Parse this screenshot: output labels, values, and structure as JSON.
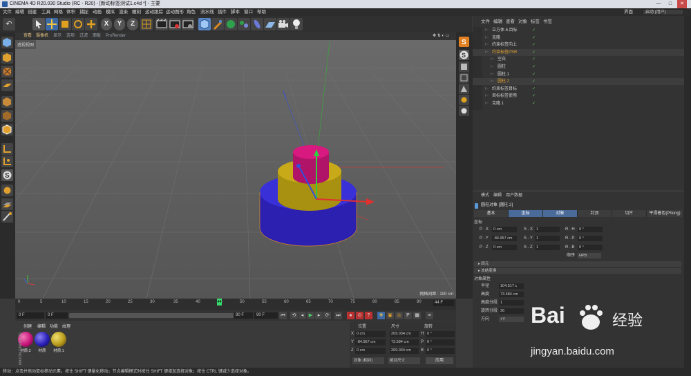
{
  "window": {
    "title": "CINEMA 4D R20.030 Studio (RC - R20) - [新动标签测试1.c4d *] - 主要",
    "min_label": "—",
    "max_label": "□",
    "close_label": "✕"
  },
  "menubar": {
    "items": [
      "文件",
      "编辑",
      "创建",
      "工具",
      "网格",
      "体积",
      "捕捉",
      "动画",
      "模拟",
      "渲染",
      "雕刻",
      "运动跟踪",
      "运动图形",
      "角色",
      "流水线",
      "插件",
      "脚本",
      "窗口",
      "帮助"
    ],
    "layout_label": "界面",
    "layout_value": "启动 (用户)"
  },
  "viewport": {
    "menu": [
      "查看",
      "摄像机",
      "显示",
      "选项",
      "过滤",
      "面板",
      "ProRender"
    ],
    "title": "透视视图",
    "grid_info": "网格间距 : 100 cm"
  },
  "timeline": {
    "ticks": [
      "0",
      "5",
      "10",
      "15",
      "20",
      "25",
      "30",
      "35",
      "40",
      "45",
      "50",
      "55",
      "60",
      "65",
      "70",
      "75",
      "80",
      "85",
      "90"
    ],
    "current_frame": "44",
    "end_label": "44 F"
  },
  "transport": {
    "start": "0 F",
    "cur": "0 F",
    "end": "90 F",
    "end2": "90 F"
  },
  "materials": {
    "tabs": [
      "创建",
      "编辑",
      "功能",
      "纹理"
    ],
    "items": [
      {
        "label": "材质.2",
        "color": "#c8157a"
      },
      {
        "label": "材质",
        "color": "#2a1fb8"
      },
      {
        "label": "材质.1",
        "color": "#b89a1a"
      }
    ]
  },
  "coords": {
    "headers": [
      "位置",
      "尺寸",
      "旋转"
    ],
    "rows": [
      {
        "axis": "X",
        "pos": "0 cm",
        "size": "209.034 cm",
        "rot_label": "H",
        "rot": "0 °"
      },
      {
        "axis": "Y",
        "pos": "-84.957 cm",
        "size": "73.584 cm",
        "rot_label": "P",
        "rot": "0 °"
      },
      {
        "axis": "Z",
        "pos": "0 cm",
        "size": "209.034 cm",
        "rot_label": "B",
        "rot": "0 °"
      }
    ],
    "mode_left": "对象 (相对)",
    "mode_right": "绝对尺寸",
    "apply": "应用"
  },
  "objects": {
    "tabs": [
      "文件",
      "编辑",
      "查看",
      "对象",
      "标签",
      "书签"
    ],
    "rows": [
      {
        "name": "立方体.6.目标",
        "indent": 0,
        "color": "#cfcfcf"
      },
      {
        "name": "克隆",
        "indent": 0,
        "color": "#cfcfcf"
      },
      {
        "name": "约束标签向上",
        "indent": 0,
        "color": "#cfcfcf"
      },
      {
        "name": "约束标签PSR",
        "indent": 0,
        "color": "#e0a030"
      },
      {
        "name": "空白",
        "indent": 1,
        "color": "#cfcfcf"
      },
      {
        "name": "圆柱",
        "indent": 1,
        "color": "#cfcfcf"
      },
      {
        "name": "圆柱.1",
        "indent": 1,
        "color": "#cfcfcf"
      },
      {
        "name": "圆柱.2",
        "indent": 1,
        "color": "#e0a030"
      },
      {
        "name": "约束标签目标",
        "indent": 0,
        "color": "#cfcfcf"
      },
      {
        "name": "目标标签使用",
        "indent": 0,
        "color": "#cfcfcf"
      },
      {
        "name": "克隆.1",
        "indent": 0,
        "color": "#cfcfcf"
      }
    ]
  },
  "attributes": {
    "tabs": [
      "模式",
      "编辑",
      "用户数据"
    ],
    "object_title": "圆柱对象 [圆柱.2]",
    "sub_tabs": [
      "基本",
      "坐标",
      "对象",
      "封顶",
      "切片",
      "平滑着色(Phong)"
    ],
    "section_coord": "坐标",
    "rows": [
      {
        "p": "P . X",
        "pv": "0 cm",
        "s": "S . X",
        "sv": "1",
        "r": "R . H",
        "rv": "0 °"
      },
      {
        "p": "P . Y",
        "pv": "-84.957 cm",
        "s": "S . Y",
        "sv": "1",
        "r": "R . P",
        "rv": "0 °"
      },
      {
        "p": "P . Z",
        "pv": "0 cm",
        "s": "S . Z",
        "sv": "1",
        "r": "R . B",
        "rv": "0 °"
      }
    ],
    "order_label": "顺序",
    "order_value": "HPB",
    "quat": "▸ 四元",
    "freeze": "▸ 冻结变换",
    "section_obj": "对象属性",
    "props": [
      {
        "label": "半径",
        "value": "104.517 c"
      },
      {
        "label": "高度",
        "value": "73.584 cm"
      },
      {
        "label": "高度分段",
        "value": "1"
      },
      {
        "label": "旋转分段",
        "value": "36"
      },
      {
        "label": "方向",
        "value": "+Y"
      }
    ]
  },
  "status": "移动：点击并拖动鼠标移动元素。按住 SHIFT 键量化移动；节点编辑模式时按住 SHIFT 键增加选择对象；按住 CTRL 键减少选择对象。",
  "brand": {
    "side": "MAXON CINEMA 4D"
  },
  "watermark": {
    "main": "Bai",
    "cn": "经验",
    "url": "jingyan.baidu.com"
  },
  "axes": {
    "x": "X",
    "y": "Y",
    "z": "Z"
  }
}
